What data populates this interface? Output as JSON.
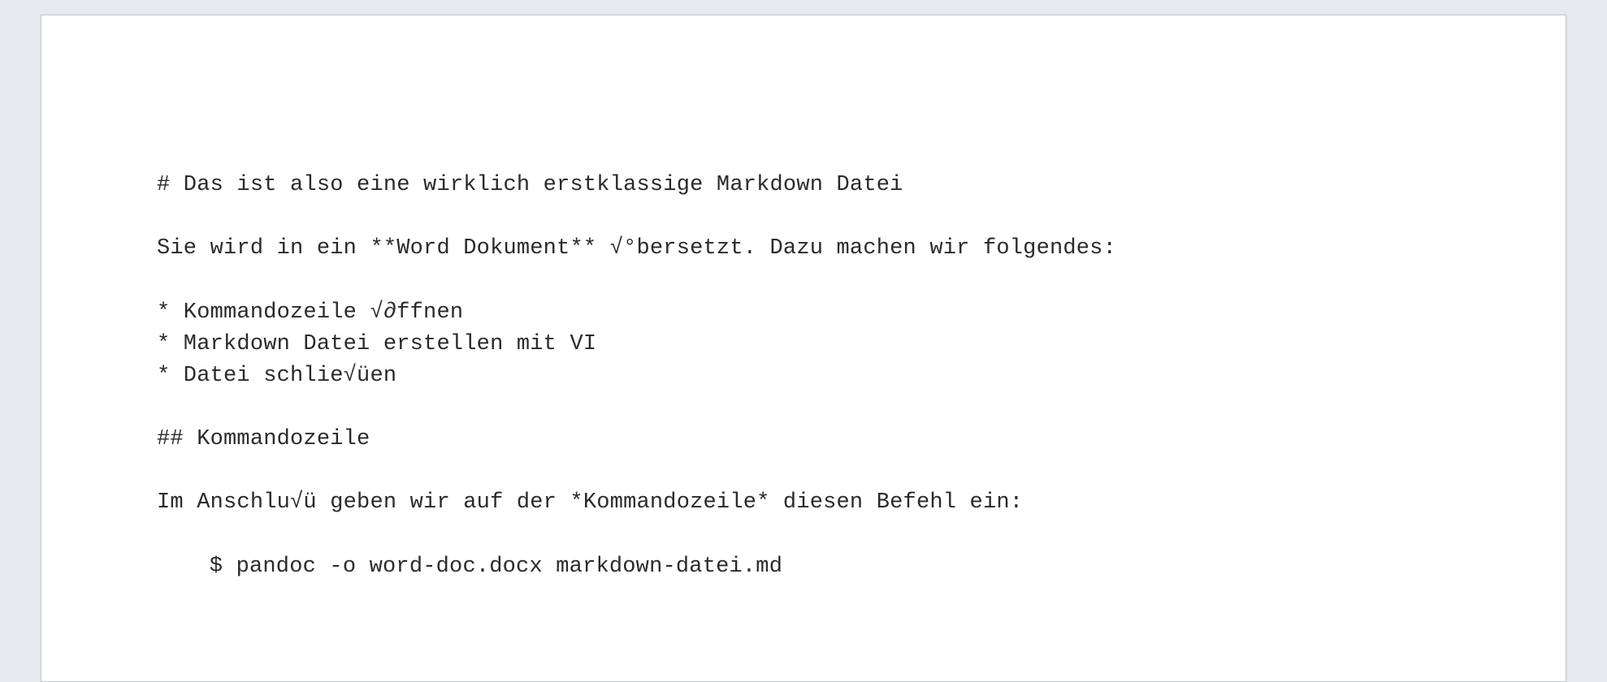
{
  "doc": {
    "heading1_raw": "# Das ist also eine wirklich erstklassige Markdown Datei",
    "para1_raw": "Sie wird in ein **Word Dokument** √°bersetzt. Dazu machen wir folgendes:",
    "list_item1_raw": "* Kommandozeile √∂ffnen",
    "list_item2_raw": "* Markdown Datei erstellen mit VI",
    "list_item3_raw": "* Datei schlie√üen",
    "heading2_raw": "## Kommandozeile",
    "para2_raw": "Im Anschlu√ü geben wir auf der *Kommandozeile* diesen Befehl ein:",
    "code_raw": "$ pandoc -o word-doc.docx markdown-datei.md"
  }
}
